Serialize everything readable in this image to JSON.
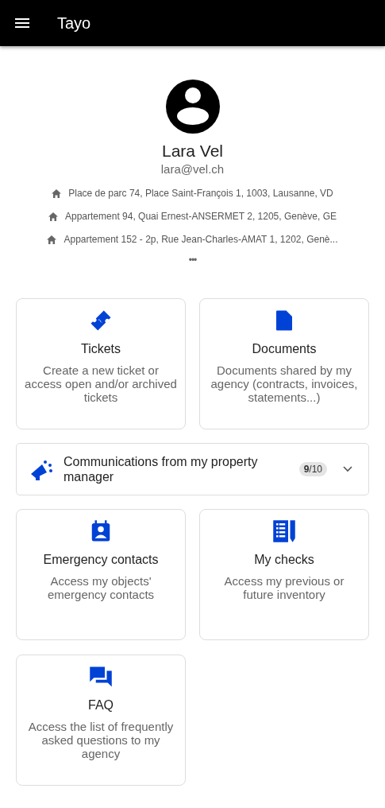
{
  "app_bar": {
    "title": "Tayo"
  },
  "profile": {
    "name": "Lara Vel",
    "email": "lara@vel.ch",
    "addresses": [
      "Place de parc 74, Place Saint-François 1, 1003, Lausanne, VD",
      "Appartement 94, Quai Ernest-ANSERMET 2, 1205, Genève, GE",
      "Appartement 152 - 2p, Rue Jean-Charles-AMAT 1, 1202, Genè..."
    ],
    "more": "•••"
  },
  "cards_top": [
    {
      "kind": "ticket",
      "title": "Tickets",
      "description": "Create a new ticket or access open and/or archived tickets"
    },
    {
      "kind": "document",
      "title": "Documents",
      "description": "Documents shared by my agency (contracts, invoices, statements...)"
    }
  ],
  "communications": {
    "label": "Communications from my property manager",
    "count": "**9**/10",
    "expanded": false
  },
  "cards_bottom": [
    {
      "kind": "contact",
      "title": "Emergency contacts",
      "description": "Access my objects' emergency contacts"
    },
    {
      "kind": "checklist",
      "title": "My checks",
      "description": "Access my previous or future inventory"
    },
    {
      "kind": "chat",
      "title": "FAQ",
      "description": "Access the list of frequently asked questions to my agency"
    }
  ]
}
